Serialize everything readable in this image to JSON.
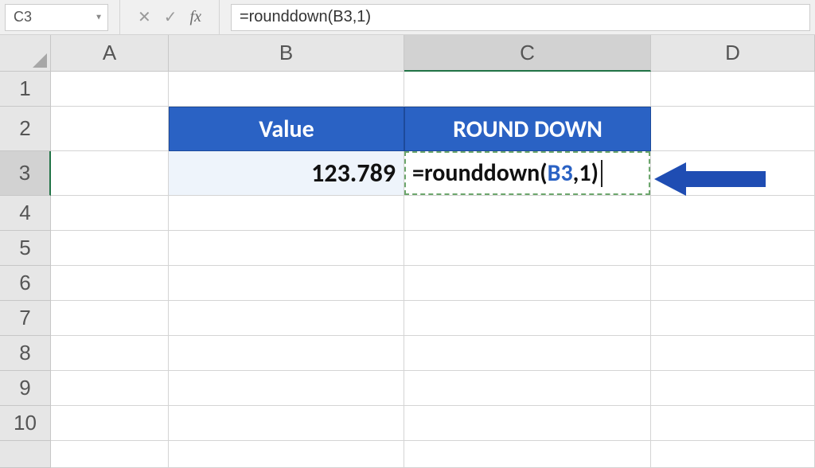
{
  "formula_bar": {
    "name_box": "C3",
    "cancel": "✕",
    "accept": "✓",
    "fx": "fx",
    "formula": "=rounddown(B3,1)"
  },
  "col_headers": [
    "A",
    "B",
    "C",
    "D"
  ],
  "row_headers": [
    "1",
    "2",
    "3",
    "4",
    "5",
    "6",
    "7",
    "8",
    "9",
    "10"
  ],
  "table": {
    "header": {
      "B": "Value",
      "C": "ROUND DOWN"
    },
    "row3": {
      "B": "123.789",
      "C_prefix": "=rounddown(",
      "C_ref": "B3",
      "C_suffix": ",1)"
    }
  },
  "chart_data": {
    "type": "table",
    "columns": [
      "Value",
      "ROUND DOWN"
    ],
    "rows": [
      {
        "Value": 123.789,
        "ROUND DOWN": "=rounddown(B3,1)"
      }
    ]
  }
}
